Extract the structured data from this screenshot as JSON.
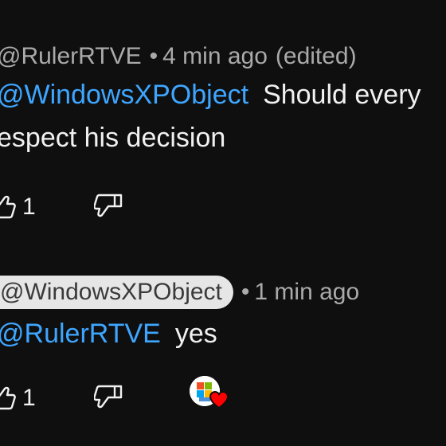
{
  "comments": [
    {
      "author": "@RulerRTVE",
      "separator": "•",
      "time": "4 min ago",
      "edited": "(edited)",
      "mention": "@WindowsXPObject",
      "text_line1": "Should every",
      "text_line2": "espect his decision",
      "like_count": "1"
    },
    {
      "author": "@WindowsXPObject",
      "separator": "•",
      "time": "1 min ago",
      "mention": "@RulerRTVE",
      "text_line1": "yes",
      "like_count": "1"
    }
  ],
  "icons": {
    "like": "thumb-up-icon",
    "dislike": "thumb-down-icon",
    "creator_heart": "creator-heart-icon"
  },
  "colors": {
    "background": "#0f0f0f",
    "mention": "#3ea6ff",
    "meta": "#aaaaaa",
    "heart": "#ff0000"
  }
}
